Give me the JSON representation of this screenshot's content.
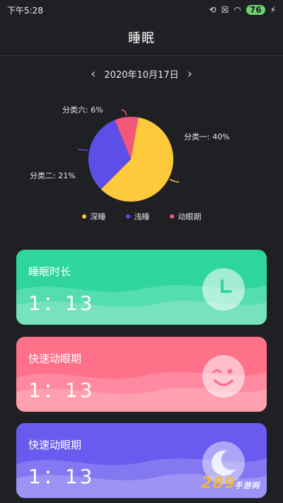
{
  "status_bar": {
    "time": "下午5:28",
    "battery": "76"
  },
  "header": {
    "title": "睡眠"
  },
  "date_nav": {
    "date": "2020年10月17日",
    "prev": "‹",
    "next": "›"
  },
  "chart_data": {
    "type": "pie",
    "slices": [
      {
        "label": "分类一: 40%",
        "value": 40,
        "color": "#ffc93c"
      },
      {
        "label": "分类二: 21%",
        "value": 21,
        "color": "#5c4fe8"
      },
      {
        "label": "分类六: 6%",
        "value": 6,
        "color": "#f2577a"
      }
    ],
    "legend": [
      {
        "name": "深睡",
        "color": "#ffc93c"
      },
      {
        "name": "浅睡",
        "color": "#5c4fe8"
      },
      {
        "name": "动眼期",
        "color": "#f2577a"
      }
    ]
  },
  "cards": [
    {
      "title": "睡眠时长",
      "value": "1：13",
      "color_top": "#2fd69b",
      "color_bottom": "#7de8c4",
      "icon": "clock-icon"
    },
    {
      "title": "快速动眼期",
      "value": "1：13",
      "color_top": "#ff7089",
      "color_bottom": "#ffb0bf",
      "icon": "wink-face-icon"
    },
    {
      "title": "快速动眼期",
      "value": "1：13",
      "color_top": "#6a5bf0",
      "color_bottom": "#a59df7",
      "icon": "moon-icon"
    }
  ],
  "watermark": {
    "text": "289",
    "suffix": "手游网"
  }
}
